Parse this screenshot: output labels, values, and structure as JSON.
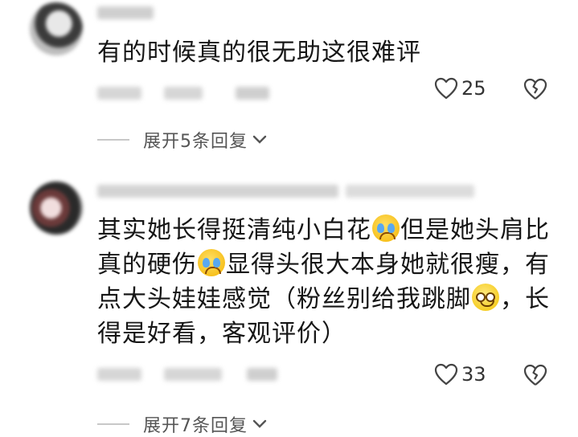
{
  "comments": [
    {
      "text": "有的时候真的很无助这很难评",
      "likes": "25",
      "expand_label": "展开5条回复"
    },
    {
      "text_parts": [
        "其实她长得挺清纯小白花",
        "但是她头肩比真的硬伤",
        "显得头很大本身她就很瘦，有点大头娃娃感觉（粉丝别给我跳脚",
        "，长得是好看，客观评价）"
      ],
      "likes": "33",
      "expand_label": "展开7条回复"
    }
  ]
}
